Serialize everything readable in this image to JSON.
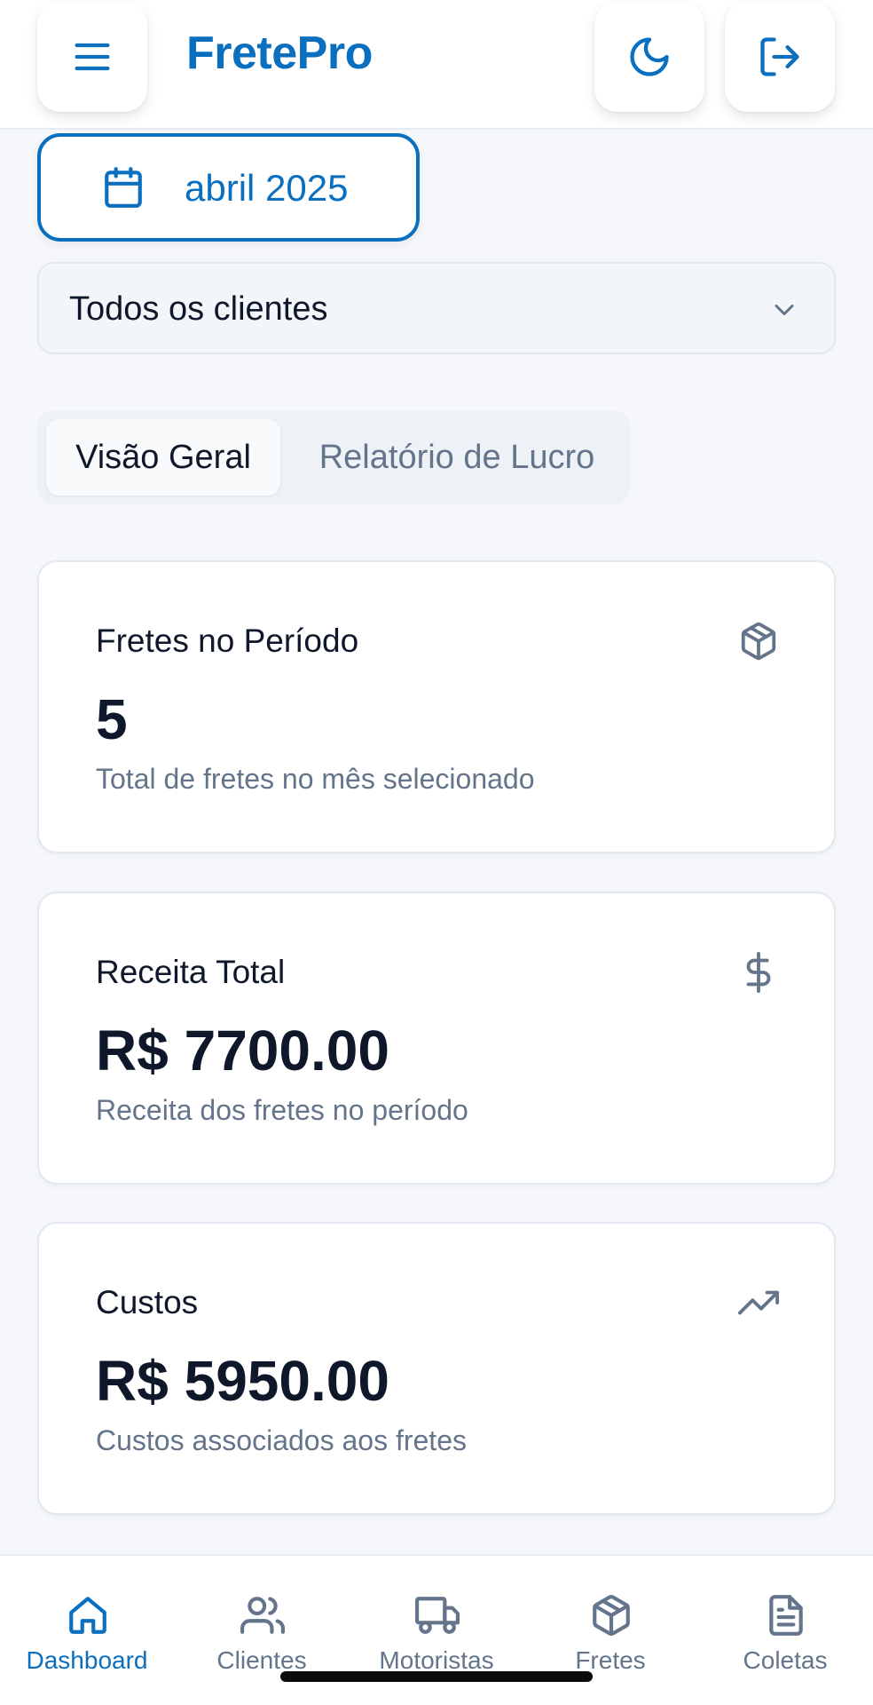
{
  "header": {
    "title": "FretePro",
    "menu_icon": "menu-icon",
    "theme_icon": "moon-icon",
    "logout_icon": "logout-icon"
  },
  "month_picker": {
    "label": "abril 2025",
    "icon": "calendar-icon"
  },
  "client_filter": {
    "selected": "Todos os clientes"
  },
  "tabs": [
    {
      "label": "Visão Geral",
      "active": true
    },
    {
      "label": "Relatório de Lucro",
      "active": false
    }
  ],
  "cards": [
    {
      "title": "Fretes no Período",
      "value": "5",
      "description": "Total de fretes no mês selecionado",
      "icon": "package-icon"
    },
    {
      "title": "Receita Total",
      "value": "R$ 7700.00",
      "description": "Receita dos fretes no período",
      "icon": "dollar-icon"
    },
    {
      "title": "Custos",
      "value": "R$ 5950.00",
      "description": "Custos associados aos fretes",
      "icon": "trending-up-icon"
    }
  ],
  "bottom_nav": [
    {
      "label": "Dashboard",
      "icon": "home-icon",
      "active": true
    },
    {
      "label": "Clientes",
      "icon": "users-icon",
      "active": false
    },
    {
      "label": "Motoristas",
      "icon": "truck-icon",
      "active": false
    },
    {
      "label": "Fretes",
      "icon": "package-icon",
      "active": false
    },
    {
      "label": "Coletas",
      "icon": "file-text-icon",
      "active": false
    }
  ],
  "colors": {
    "primary": "#0a6fbf",
    "muted_text": "#64748b",
    "text": "#0f172a",
    "background": "#f5f7fa"
  }
}
